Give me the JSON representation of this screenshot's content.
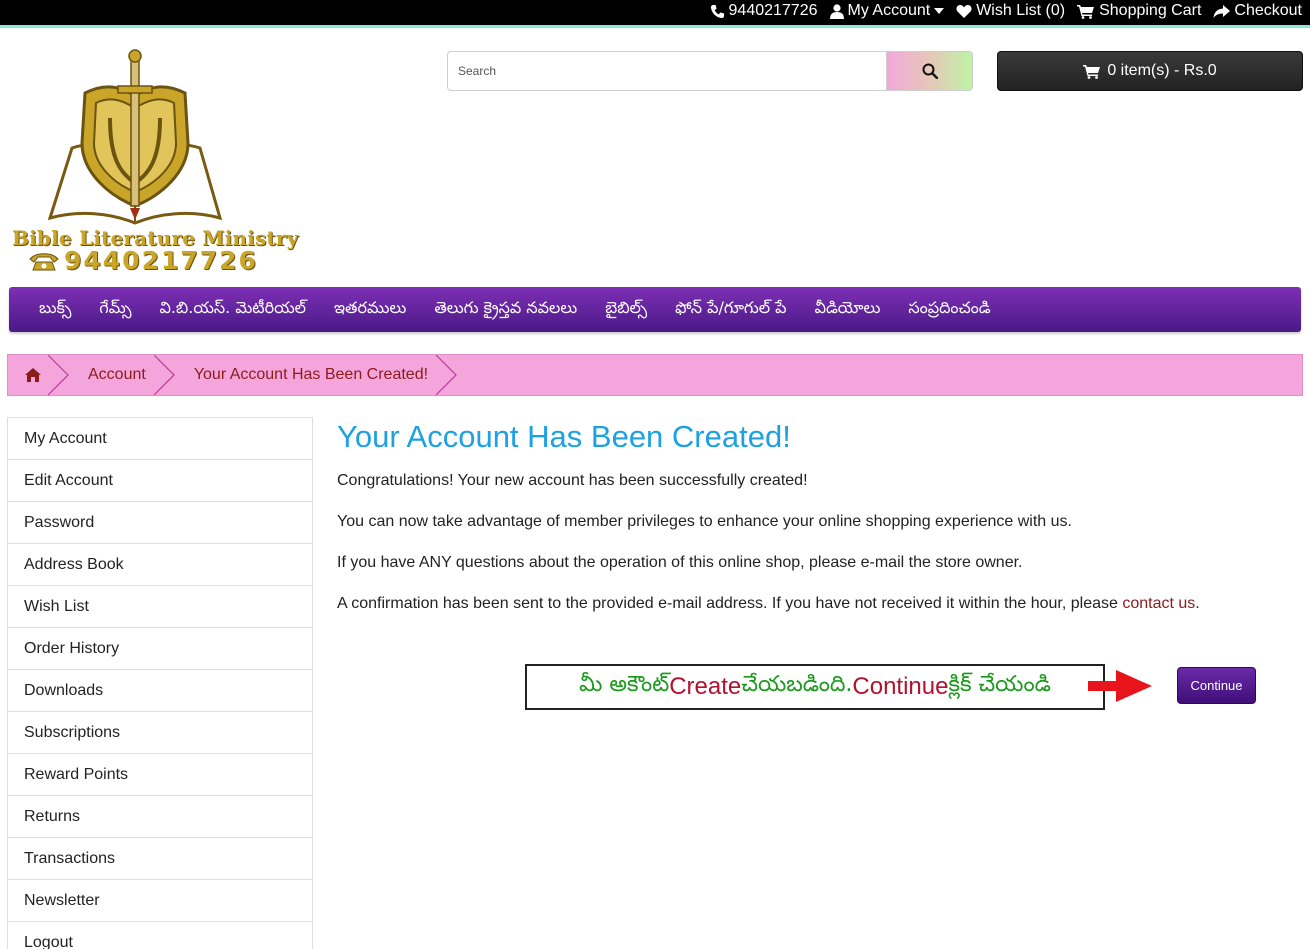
{
  "topbar": {
    "phone": "9440217726",
    "my_account": "My Account",
    "wish_list": "Wish List (0)",
    "shopping_cart": "Shopping Cart",
    "checkout": "Checkout"
  },
  "logo": {
    "title": "Bible Literature Ministry",
    "phone": "9440217726"
  },
  "search": {
    "placeholder": "Search"
  },
  "cart": {
    "label": "0 item(s) - Rs.0"
  },
  "menu": {
    "items": [
      "బుక్స్",
      "గేమ్స్",
      "వి.బి.యస్. మెటీరియల్",
      "ఇతరములు",
      "తెలుగు క్రైస్తవ నవలలు",
      "బైబిల్స్",
      "ఫోన్ పే/గూగుల్ పే",
      "వీడియోలు",
      "సంప్రదించండి"
    ]
  },
  "breadcrumb": {
    "items": [
      "Account",
      "Your Account Has Been Created!"
    ]
  },
  "sidebar": {
    "items": [
      "My Account",
      "Edit Account",
      "Password",
      "Address Book",
      "Wish List",
      "Order History",
      "Downloads",
      "Subscriptions",
      "Reward Points",
      "Returns",
      "Transactions",
      "Newsletter",
      "Logout"
    ]
  },
  "content": {
    "title": "Your Account Has Been Created!",
    "p1": "Congratulations! Your new account has been successfully created!",
    "p2": "You can now take advantage of member privileges to enhance your online shopping experience with us.",
    "p3": "If you have ANY questions about the operation of this online shop, please e-mail the store owner.",
    "p4": "A confirmation has been sent to the provided e-mail address. If you have not received it within the hour, please ",
    "contact_link": "contact us",
    "p4_end": "."
  },
  "note": {
    "part1": "మీ అకౌంట్ ",
    "part2": "Create",
    "part3": " చేయబడింది. ",
    "part4": "Continue",
    "part5": " క్లిక్ చేయండి"
  },
  "continue_button": "Continue",
  "colors": {
    "menu": "#5a1f98",
    "breadcrumb": "#f4a6dc",
    "title": "#1da1e3",
    "link": "#8a1c1c"
  }
}
